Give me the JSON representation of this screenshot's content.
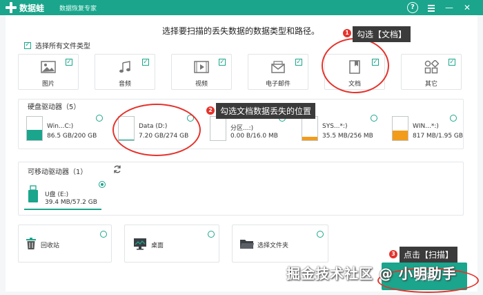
{
  "app": {
    "name": "数据蛙",
    "subtitle": "数据恢复专家"
  },
  "instruction": "选择要扫描的丢失数据的数据类型和路径。",
  "select_all_label": "选择所有文件类型",
  "file_types": [
    {
      "label": "图片",
      "icon": "image-icon",
      "checked": true
    },
    {
      "label": "音频",
      "icon": "music-icon",
      "checked": true
    },
    {
      "label": "视频",
      "icon": "video-icon",
      "checked": true
    },
    {
      "label": "电子邮件",
      "icon": "mail-icon",
      "checked": true
    },
    {
      "label": "文档",
      "icon": "document-icon",
      "checked": true
    },
    {
      "label": "其它",
      "icon": "other-icon",
      "checked": true
    }
  ],
  "hard_drives": {
    "title": "硬盘驱动器（5）",
    "drives": [
      {
        "name": "Win...C:)",
        "size": "86.5 GB/200 GB",
        "fill_percent": 43,
        "color": "#1aa58c"
      },
      {
        "name": "Data (D:)",
        "size": "7.20 GB/274 GB",
        "fill_percent": 3,
        "color": "#1aa58c"
      },
      {
        "name": "分区...:)",
        "size": "0.00  B/16.0 MB",
        "fill_percent": 0,
        "color": "#1aa58c"
      },
      {
        "name": "SYS...*:)",
        "size": "35.5 MB/256 MB",
        "fill_percent": 14,
        "color": "#f39b1a"
      },
      {
        "name": "WIN...*:)",
        "size": "817 MB/1.95 GB",
        "fill_percent": 41,
        "color": "#f39b1a"
      }
    ]
  },
  "removable": {
    "title": "可移动驱动器（1）",
    "drives": [
      {
        "name": "U盘 (E:)",
        "size": "39.4 MB/57.2 GB",
        "selected": true
      }
    ]
  },
  "locations": [
    {
      "label": "回收站",
      "icon": "trash-icon"
    },
    {
      "label": "桌面",
      "icon": "desktop-icon"
    },
    {
      "label": "选择文件夹",
      "icon": "folder-icon"
    }
  ],
  "scan_button": "扫描",
  "annotations": [
    {
      "num": "1",
      "text": "勾选【文档】"
    },
    {
      "num": "2",
      "text": "勾选文档数据丢失的位置"
    },
    {
      "num": "3",
      "text": "点击【扫描】"
    }
  ],
  "watermark": "掘金技术社区 @ 小明助手",
  "colors": {
    "accent": "#1aa58c",
    "annotation_red": "#e5322b",
    "warn_orange": "#f39b1a"
  }
}
